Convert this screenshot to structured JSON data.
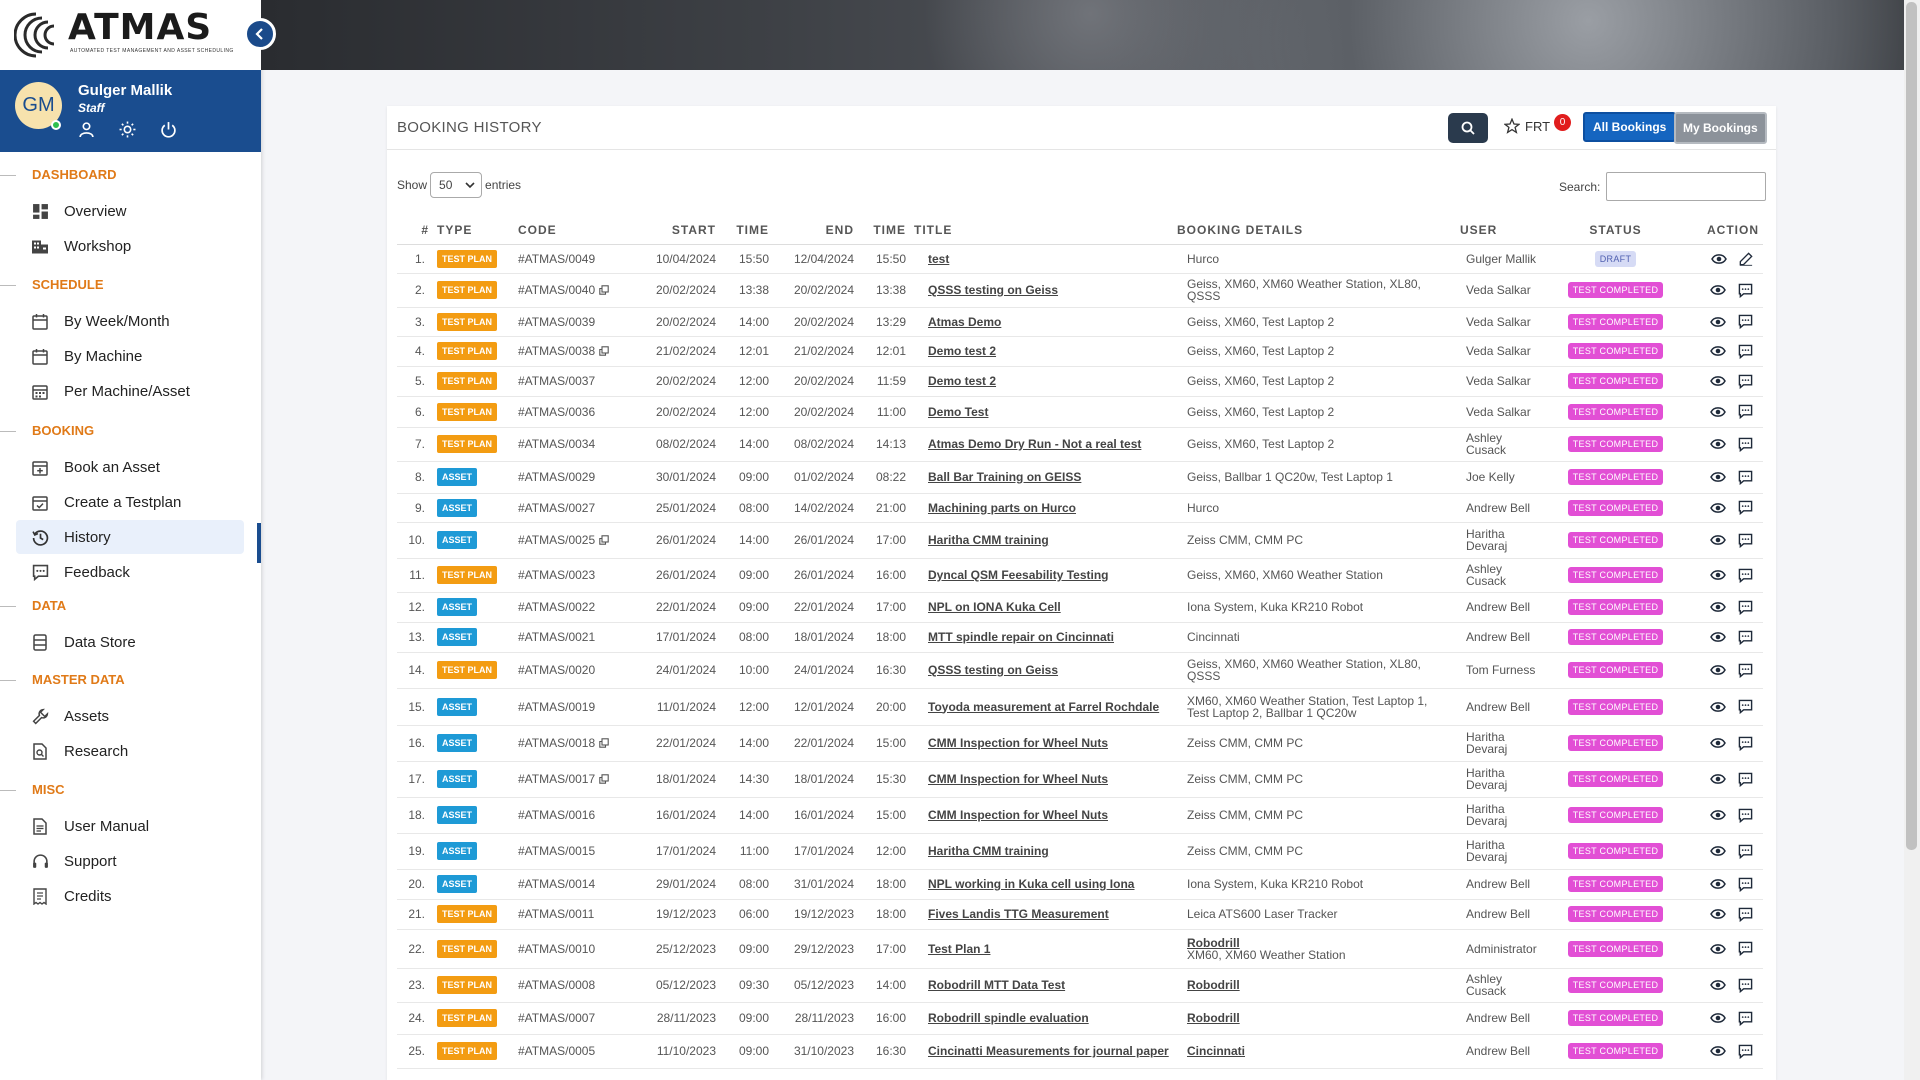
{
  "app": {
    "logo_text": "ATMAS",
    "logo_tagline": "AUTOMATED TEST MANAGEMENT AND ASSET SCHEDULING"
  },
  "user": {
    "initials": "GM",
    "name": "Gulger Mallik",
    "role": "Staff"
  },
  "nav": {
    "sections": [
      {
        "label": "DASHBOARD",
        "items": [
          {
            "label": "Overview",
            "icon": "grid-icon"
          },
          {
            "label": "Workshop",
            "icon": "building-icon"
          }
        ]
      },
      {
        "label": "SCHEDULE",
        "items": [
          {
            "label": "By Week/Month",
            "icon": "calendar-icon"
          },
          {
            "label": "By Machine",
            "icon": "calendar-icon"
          },
          {
            "label": "Per Machine/Asset",
            "icon": "calendar-grid-icon"
          }
        ]
      },
      {
        "label": "BOOKING",
        "items": [
          {
            "label": "Book an Asset",
            "icon": "calendar-plus-icon"
          },
          {
            "label": "Create a Testplan",
            "icon": "calendar-check-icon"
          },
          {
            "label": "History",
            "icon": "history-icon",
            "active": true
          },
          {
            "label": "Feedback",
            "icon": "chat-icon"
          }
        ]
      },
      {
        "label": "DATA",
        "items": [
          {
            "label": "Data Store",
            "icon": "database-icon"
          }
        ]
      },
      {
        "label": "MASTER DATA",
        "items": [
          {
            "label": "Assets",
            "icon": "wrench-icon"
          },
          {
            "label": "Research",
            "icon": "file-search-icon"
          }
        ]
      },
      {
        "label": "MISC",
        "items": [
          {
            "label": "User Manual",
            "icon": "document-icon"
          },
          {
            "label": "Support",
            "icon": "headset-icon"
          },
          {
            "label": "Credits",
            "icon": "receipt-icon"
          }
        ]
      }
    ]
  },
  "page": {
    "title": "BOOKING HISTORY",
    "frt_label": "FRT",
    "frt_count": "0",
    "all_bookings_label": "All Bookings",
    "my_bookings_label": "My Bookings",
    "show_label": "Show",
    "entries_label": "entries",
    "page_size": "50",
    "search_label": "Search:"
  },
  "table": {
    "headers": [
      "#",
      "TYPE",
      "CODE",
      "START",
      "TIME",
      "END",
      "TIME",
      "TITLE",
      "BOOKING DETAILS",
      "USER",
      "STATUS",
      "ACTION"
    ],
    "rows": [
      {
        "n": "1.",
        "type": "TEST PLAN",
        "code": "#ATMAS/0049",
        "copy": false,
        "start": "10/04/2024",
        "st": "15:50",
        "end": "12/04/2024",
        "et": "15:50",
        "title": "test",
        "details": "Hurco",
        "details_link": "",
        "user": "Gulger Mallik",
        "status": "DRAFT",
        "action": "edit"
      },
      {
        "n": "2.",
        "type": "TEST PLAN",
        "code": "#ATMAS/0040",
        "copy": true,
        "start": "20/02/2024",
        "st": "13:38",
        "end": "20/02/2024",
        "et": "13:38",
        "title": "QSSS testing on Geiss",
        "details": "Geiss, XM60, XM60 Weather Station, XL80, QSSS",
        "details_link": "",
        "user": "Veda Salkar",
        "status": "TEST COMPLETED",
        "action": "feedback"
      },
      {
        "n": "3.",
        "type": "TEST PLAN",
        "code": "#ATMAS/0039",
        "copy": false,
        "start": "20/02/2024",
        "st": "14:00",
        "end": "20/02/2024",
        "et": "13:29",
        "title": "Atmas Demo",
        "details": "Geiss, XM60, Test Laptop 2",
        "details_link": "",
        "user": "Veda Salkar",
        "status": "TEST COMPLETED",
        "action": "feedback"
      },
      {
        "n": "4.",
        "type": "TEST PLAN",
        "code": "#ATMAS/0038",
        "copy": true,
        "start": "21/02/2024",
        "st": "12:01",
        "end": "21/02/2024",
        "et": "12:01",
        "title": "Demo test 2",
        "details": "Geiss, XM60, Test Laptop 2",
        "details_link": "",
        "user": "Veda Salkar",
        "status": "TEST COMPLETED",
        "action": "feedback"
      },
      {
        "n": "5.",
        "type": "TEST PLAN",
        "code": "#ATMAS/0037",
        "copy": false,
        "start": "20/02/2024",
        "st": "12:00",
        "end": "20/02/2024",
        "et": "11:59",
        "title": "Demo test 2",
        "details": "Geiss, XM60, Test Laptop 2",
        "details_link": "",
        "user": "Veda Salkar",
        "status": "TEST COMPLETED",
        "action": "feedback"
      },
      {
        "n": "6.",
        "type": "TEST PLAN",
        "code": "#ATMAS/0036",
        "copy": false,
        "start": "20/02/2024",
        "st": "12:00",
        "end": "20/02/2024",
        "et": "11:00",
        "title": "Demo Test",
        "details": "Geiss, XM60, Test Laptop 2",
        "details_link": "",
        "user": "Veda Salkar",
        "status": "TEST COMPLETED",
        "action": "feedback"
      },
      {
        "n": "7.",
        "type": "TEST PLAN",
        "code": "#ATMAS/0034",
        "copy": false,
        "start": "08/02/2024",
        "st": "14:00",
        "end": "08/02/2024",
        "et": "14:13",
        "title": "Atmas Demo Dry Run - Not a real test",
        "details": "Geiss, XM60, Test Laptop 2",
        "details_link": "",
        "user": "Ashley Cusack",
        "status": "TEST COMPLETED",
        "action": "feedback"
      },
      {
        "n": "8.",
        "type": "ASSET",
        "code": "#ATMAS/0029",
        "copy": false,
        "start": "30/01/2024",
        "st": "09:00",
        "end": "01/02/2024",
        "et": "08:22",
        "title": "Ball Bar Training on GEISS",
        "details": "Geiss, Ballbar 1 QC20w, Test Laptop 1",
        "details_link": "",
        "user": "Joe Kelly",
        "status": "TEST COMPLETED",
        "action": "feedback"
      },
      {
        "n": "9.",
        "type": "ASSET",
        "code": "#ATMAS/0027",
        "copy": false,
        "start": "25/01/2024",
        "st": "08:00",
        "end": "14/02/2024",
        "et": "21:00",
        "title": "Machining parts on Hurco",
        "details": "Hurco",
        "details_link": "",
        "user": "Andrew Bell",
        "status": "TEST COMPLETED",
        "action": "feedback"
      },
      {
        "n": "10.",
        "type": "ASSET",
        "code": "#ATMAS/0025",
        "copy": true,
        "start": "26/01/2024",
        "st": "14:00",
        "end": "26/01/2024",
        "et": "17:00",
        "title": "Haritha CMM training",
        "details": "Zeiss CMM, CMM PC",
        "details_link": "",
        "user": "Haritha Devaraj",
        "status": "TEST COMPLETED",
        "action": "feedback"
      },
      {
        "n": "11.",
        "type": "TEST PLAN",
        "code": "#ATMAS/0023",
        "copy": false,
        "start": "26/01/2024",
        "st": "09:00",
        "end": "26/01/2024",
        "et": "16:00",
        "title": "Dyncal QSM Feesability Testing",
        "details": "Geiss, XM60, XM60 Weather Station",
        "details_link": "",
        "user": "Ashley Cusack",
        "status": "TEST COMPLETED",
        "action": "feedback"
      },
      {
        "n": "12.",
        "type": "ASSET",
        "code": "#ATMAS/0022",
        "copy": false,
        "start": "22/01/2024",
        "st": "09:00",
        "end": "22/01/2024",
        "et": "17:00",
        "title": "NPL on IONA Kuka Cell",
        "details": "Iona System, Kuka KR210 Robot",
        "details_link": "",
        "user": "Andrew Bell",
        "status": "TEST COMPLETED",
        "action": "feedback"
      },
      {
        "n": "13.",
        "type": "ASSET",
        "code": "#ATMAS/0021",
        "copy": false,
        "start": "17/01/2024",
        "st": "08:00",
        "end": "18/01/2024",
        "et": "18:00",
        "title": "MTT spindle repair on Cincinnati",
        "details": "Cincinnati",
        "details_link": "",
        "user": "Andrew Bell",
        "status": "TEST COMPLETED",
        "action": "feedback"
      },
      {
        "n": "14.",
        "type": "TEST PLAN",
        "code": "#ATMAS/0020",
        "copy": false,
        "start": "24/01/2024",
        "st": "10:00",
        "end": "24/01/2024",
        "et": "16:30",
        "title": "QSSS testing on Geiss",
        "details": "Geiss, XM60, XM60 Weather Station, XL80, QSSS",
        "details_link": "",
        "user": "Tom Furness",
        "status": "TEST COMPLETED",
        "action": "feedback"
      },
      {
        "n": "15.",
        "type": "ASSET",
        "code": "#ATMAS/0019",
        "copy": false,
        "start": "11/01/2024",
        "st": "12:00",
        "end": "12/01/2024",
        "et": "20:00",
        "title": "Toyoda measurement at Farrel Rochdale",
        "details": "XM60, XM60 Weather Station, Test Laptop 1, Test Laptop 2, Ballbar 1 QC20w",
        "details_link": "",
        "user": "Andrew Bell",
        "status": "TEST COMPLETED",
        "action": "feedback"
      },
      {
        "n": "16.",
        "type": "ASSET",
        "code": "#ATMAS/0018",
        "copy": true,
        "start": "22/01/2024",
        "st": "14:00",
        "end": "22/01/2024",
        "et": "15:00",
        "title": "CMM Inspection for Wheel Nuts",
        "details": "Zeiss CMM, CMM PC",
        "details_link": "",
        "user": "Haritha Devaraj",
        "status": "TEST COMPLETED",
        "action": "feedback"
      },
      {
        "n": "17.",
        "type": "ASSET",
        "code": "#ATMAS/0017",
        "copy": true,
        "start": "18/01/2024",
        "st": "14:30",
        "end": "18/01/2024",
        "et": "15:30",
        "title": "CMM Inspection for Wheel Nuts",
        "details": "Zeiss CMM, CMM PC",
        "details_link": "",
        "user": "Haritha Devaraj",
        "status": "TEST COMPLETED",
        "action": "feedback"
      },
      {
        "n": "18.",
        "type": "ASSET",
        "code": "#ATMAS/0016",
        "copy": false,
        "start": "16/01/2024",
        "st": "14:00",
        "end": "16/01/2024",
        "et": "15:00",
        "title": "CMM Inspection for Wheel Nuts",
        "details": "Zeiss CMM, CMM PC",
        "details_link": "",
        "user": "Haritha Devaraj",
        "status": "TEST COMPLETED",
        "action": "feedback"
      },
      {
        "n": "19.",
        "type": "ASSET",
        "code": "#ATMAS/0015",
        "copy": false,
        "start": "17/01/2024",
        "st": "11:00",
        "end": "17/01/2024",
        "et": "12:00",
        "title": "Haritha CMM training",
        "details": "Zeiss CMM, CMM PC",
        "details_link": "",
        "user": "Haritha Devaraj",
        "status": "TEST COMPLETED",
        "action": "feedback"
      },
      {
        "n": "20.",
        "type": "ASSET",
        "code": "#ATMAS/0014",
        "copy": false,
        "start": "29/01/2024",
        "st": "08:00",
        "end": "31/01/2024",
        "et": "18:00",
        "title": "NPL working in Kuka cell using Iona",
        "details": "Iona System, Kuka KR210 Robot",
        "details_link": "",
        "user": "Andrew Bell",
        "status": "TEST COMPLETED",
        "action": "feedback"
      },
      {
        "n": "21.",
        "type": "TEST PLAN",
        "code": "#ATMAS/0011",
        "copy": false,
        "start": "19/12/2023",
        "st": "06:00",
        "end": "19/12/2023",
        "et": "18:00",
        "title": "Fives Landis TTG Measurement",
        "details": "Leica ATS600 Laser Tracker",
        "details_link": "",
        "user": "Andrew Bell",
        "status": "TEST COMPLETED",
        "action": "feedback"
      },
      {
        "n": "22.",
        "type": "TEST PLAN",
        "code": "#ATMAS/0010",
        "copy": false,
        "start": "25/12/2023",
        "st": "09:00",
        "end": "29/12/2023",
        "et": "17:00",
        "title": "Test Plan 1",
        "details": "XM60, XM60 Weather Station",
        "details_link": "Robodrill",
        "user": "Administrator",
        "status": "TEST COMPLETED",
        "action": "feedback"
      },
      {
        "n": "23.",
        "type": "TEST PLAN",
        "code": "#ATMAS/0008",
        "copy": false,
        "start": "05/12/2023",
        "st": "09:30",
        "end": "05/12/2023",
        "et": "14:00",
        "title": "Robodrill MTT Data Test",
        "details": "",
        "details_link": "Robodrill",
        "user": "Ashley Cusack",
        "status": "TEST COMPLETED",
        "action": "feedback"
      },
      {
        "n": "24.",
        "type": "TEST PLAN",
        "code": "#ATMAS/0007",
        "copy": false,
        "start": "28/11/2023",
        "st": "09:00",
        "end": "28/11/2023",
        "et": "16:00",
        "title": "Robodrill spindle evaluation",
        "details": "",
        "details_link": "Robodrill",
        "user": "Andrew Bell",
        "status": "TEST COMPLETED",
        "action": "feedback"
      },
      {
        "n": "25.",
        "type": "TEST PLAN",
        "code": "#ATMAS/0005",
        "copy": false,
        "start": "11/10/2023",
        "st": "09:00",
        "end": "31/10/2023",
        "et": "16:30",
        "title": "Cincinatti Measurements for journal paper",
        "details": "",
        "details_link": "Cincinnati",
        "user": "Andrew Bell",
        "status": "TEST COMPLETED",
        "action": "feedback"
      }
    ]
  }
}
